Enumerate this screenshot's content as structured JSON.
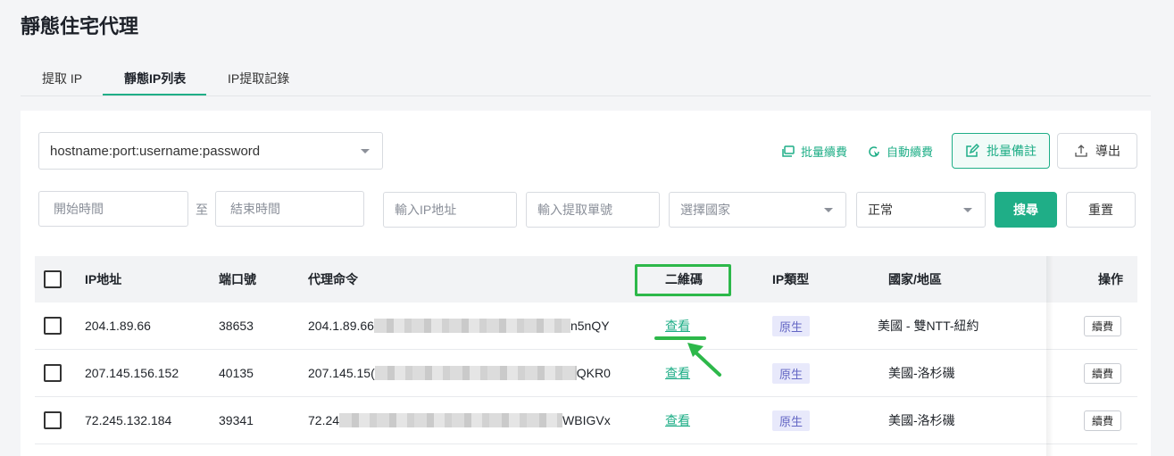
{
  "page": {
    "title": "靜態住宅代理"
  },
  "tabs": [
    {
      "label": "提取 IP",
      "active": false
    },
    {
      "label": "靜態IP列表",
      "active": true
    },
    {
      "label": "IP提取記錄",
      "active": false
    }
  ],
  "toolbar": {
    "format_select": {
      "value": "hostname:port:username:password"
    },
    "batch_renew": "批量續費",
    "auto_renew": "自動續費",
    "batch_note": "批量備註",
    "export": "導出"
  },
  "filters": {
    "start_time": {
      "placeholder": "開始時間"
    },
    "to_label": "至",
    "end_time": {
      "placeholder": "結束時間"
    },
    "ip_input": {
      "placeholder": "輸入IP地址"
    },
    "order_input": {
      "placeholder": "輸入提取單號"
    },
    "country_select": {
      "placeholder": "選擇國家"
    },
    "status_select": {
      "value": "正常"
    },
    "search_button": "搜尋",
    "reset_button": "重置"
  },
  "table": {
    "headers": {
      "ip": "IP地址",
      "port": "端口號",
      "command": "代理命令",
      "qrcode": "二維碼",
      "ip_type": "IP類型",
      "region": "國家/地區",
      "action": "操作"
    },
    "rows": [
      {
        "ip": "204.1.89.66",
        "port": "38653",
        "command_prefix": "204.1.89.66",
        "command_suffix": "n5nQY",
        "qrcode": "查看",
        "ip_type": "原生",
        "region": "美國 - 雙NTT-紐約",
        "action": "續費"
      },
      {
        "ip": "207.145.156.152",
        "port": "40135",
        "command_prefix": "207.145.15(",
        "command_suffix": "QKR0",
        "qrcode": "查看",
        "ip_type": "原生",
        "region": "美國-洛杉磯",
        "action": "續費"
      },
      {
        "ip": "72.245.132.184",
        "port": "39341",
        "command_prefix": "72.24",
        "command_suffix": "WBIGVx",
        "qrcode": "查看",
        "ip_type": "原生",
        "region": "美國-洛杉磯",
        "action": "續費"
      }
    ]
  },
  "colors": {
    "accent": "#1fae87",
    "highlight": "#2db84a",
    "badge_bg": "#e8e9fb",
    "badge_text": "#6366c4"
  },
  "icons": [
    "caret-down-icon",
    "batch-renew-icon",
    "auto-renew-icon",
    "edit-icon",
    "upload-icon",
    "pointer-arrow-icon"
  ]
}
